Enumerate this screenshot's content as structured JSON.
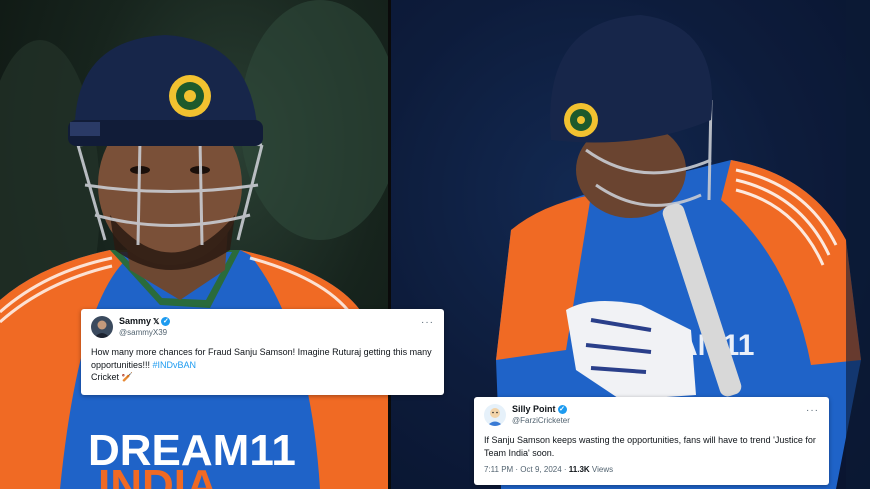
{
  "image": {
    "left_panel": {
      "subject": "batsman-looking-up",
      "jersey_text": "DREAM11",
      "jersey_text2": "INDIA"
    },
    "right_panel": {
      "subject": "batsman-head-down",
      "jersey_text": "EAM11"
    }
  },
  "tweets": [
    {
      "name": "Sammy",
      "x_badge": "𝕏",
      "handle": "@sammyX39",
      "text_before": "How many more chances for Fraud Sanju Samson! Imagine Ruturaj getting this many opportunities!!! ",
      "hashtag": "#INDvBAN",
      "text_after": "Cricket 🏏",
      "more": "···"
    },
    {
      "name": "Silly Point",
      "handle": "@FarziCricketer",
      "text": "If Sanju Samson keeps wasting the opportunities, fans will have to trend 'Justice for Team India' soon.",
      "time": "7:11 PM · Oct 9, 2024 · ",
      "views_count": "11.3K",
      "views_label": " Views",
      "more": "···"
    }
  ],
  "colors": {
    "jersey_blue": "#1f63c8",
    "jersey_orange": "#f06a24",
    "helmet_navy": "#17264a",
    "verified_blue": "#1d9bf0"
  }
}
